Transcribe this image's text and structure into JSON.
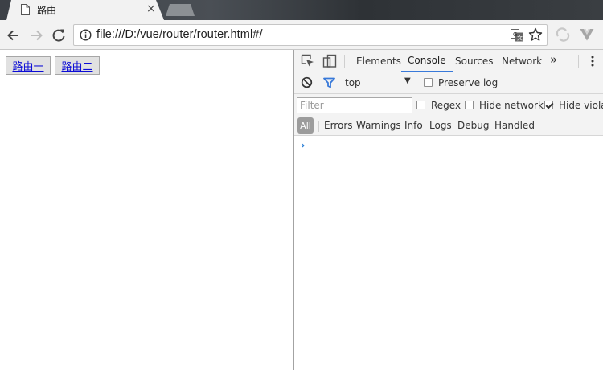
{
  "tab": {
    "title": "路由",
    "close_glyph": "×"
  },
  "address": {
    "url": "file:///D:/vue/router/router.html#/"
  },
  "page": {
    "links": [
      {
        "label": "路由一"
      },
      {
        "label": "路由二"
      }
    ]
  },
  "devtools": {
    "tabs": [
      {
        "label": "Elements"
      },
      {
        "label": "Console"
      },
      {
        "label": "Sources"
      },
      {
        "label": "Network"
      }
    ],
    "active_tab": "Console",
    "more_glyph": "»",
    "context": {
      "value": "top",
      "arrow": "▼"
    },
    "preserve_log": {
      "label": "Preserve log",
      "checked": false
    },
    "filter": {
      "placeholder": "Filter",
      "value": ""
    },
    "regex": {
      "label": "Regex",
      "checked": false
    },
    "hide_network": {
      "label": "Hide network",
      "checked": false
    },
    "hide_violations": {
      "label": "Hide violat",
      "checked": true
    },
    "levels": [
      {
        "label": "All"
      },
      {
        "label": "Errors"
      },
      {
        "label": "Warnings"
      },
      {
        "label": "Info"
      },
      {
        "label": "Logs"
      },
      {
        "label": "Debug"
      },
      {
        "label": "Handled"
      }
    ],
    "prompt": "›"
  },
  "colors": {
    "accent": "#3879d9",
    "link": "#0b0bd6",
    "prompt": "#2a7fd6"
  }
}
